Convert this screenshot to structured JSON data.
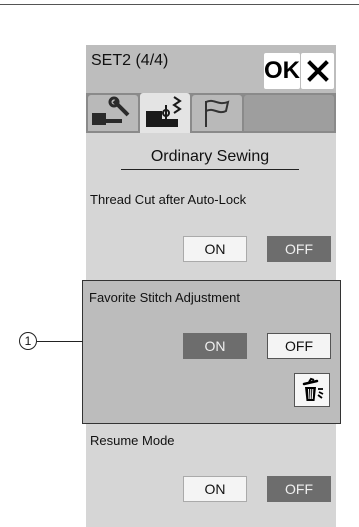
{
  "window": {
    "title": "SET2 (4/4)",
    "ok_label": "OK"
  },
  "tabs": [
    {
      "name": "settings-tab",
      "icon": "wrench-machine-icon"
    },
    {
      "name": "sewing-tab",
      "icon": "machine-needle-icon",
      "selected": true
    },
    {
      "name": "language-tab",
      "icon": "flag-icon"
    }
  ],
  "section": {
    "title": "Ordinary Sewing"
  },
  "settings": [
    {
      "label": "Thread Cut after Auto-Lock",
      "on_label": "ON",
      "off_label": "OFF",
      "selected": "OFF"
    },
    {
      "label": "Favorite Stitch Adjustment",
      "on_label": "ON",
      "off_label": "OFF",
      "selected": "ON",
      "highlighted": true
    },
    {
      "label": "Resume Mode",
      "on_label": "ON",
      "off_label": "OFF",
      "selected": "OFF"
    }
  ],
  "callout": {
    "number": "1"
  },
  "icons": {
    "close": "close-icon",
    "trash": "trash-icon"
  },
  "colors": {
    "panel": "#d6d6d6",
    "tab_bar": "#8a8a8a",
    "selected_button": "#6d6d6d",
    "highlight_box": "#bcbcbc"
  }
}
